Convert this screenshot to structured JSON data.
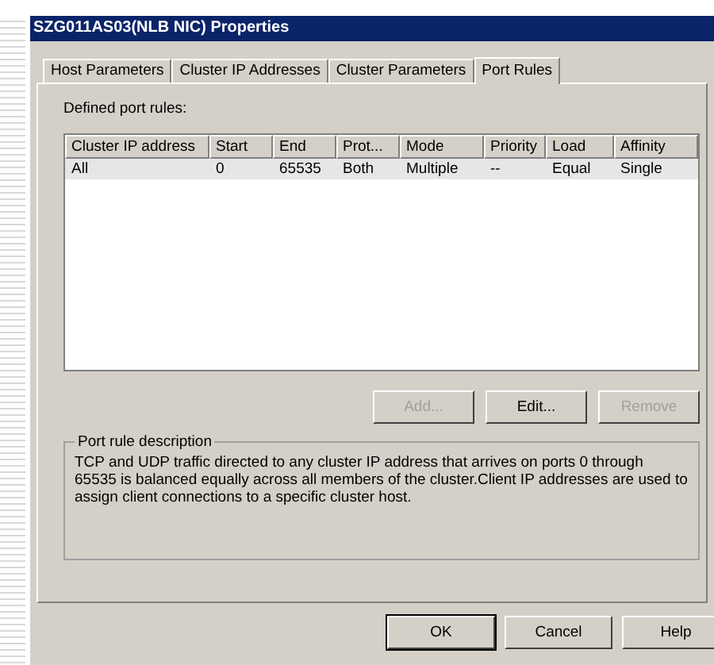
{
  "window": {
    "title": "SZG011AS03(NLB NIC) Properties"
  },
  "tabs": [
    {
      "label": "Host Parameters",
      "selected": false
    },
    {
      "label": "Cluster IP Addresses",
      "selected": false
    },
    {
      "label": "Cluster Parameters",
      "selected": false
    },
    {
      "label": "Port Rules",
      "selected": true
    }
  ],
  "list_label": "Defined port rules:",
  "table": {
    "columns": [
      "Cluster IP address",
      "Start",
      "End",
      "Prot...",
      "Mode",
      "Priority",
      "Load",
      "Affinity"
    ],
    "rows": [
      {
        "selected": true,
        "cells": [
          "All",
          "0",
          "65535",
          "Both",
          "Multiple",
          "--",
          "Equal",
          "Single"
        ]
      }
    ]
  },
  "list_buttons": [
    {
      "label": "Add...",
      "disabled": true
    },
    {
      "label": "Edit...",
      "disabled": false
    },
    {
      "label": "Remove",
      "disabled": true
    }
  ],
  "description": {
    "title": "Port rule description",
    "text": "TCP and UDP traffic directed to any cluster IP address that arrives on ports 0 through 65535 is balanced equally across all members of the cluster.Client IP addresses are used to assign client connections to a specific cluster host."
  },
  "dialog_buttons": [
    {
      "label": "OK",
      "default": true
    },
    {
      "label": "Cancel",
      "default": false
    },
    {
      "label": "Help",
      "default": false
    }
  ]
}
